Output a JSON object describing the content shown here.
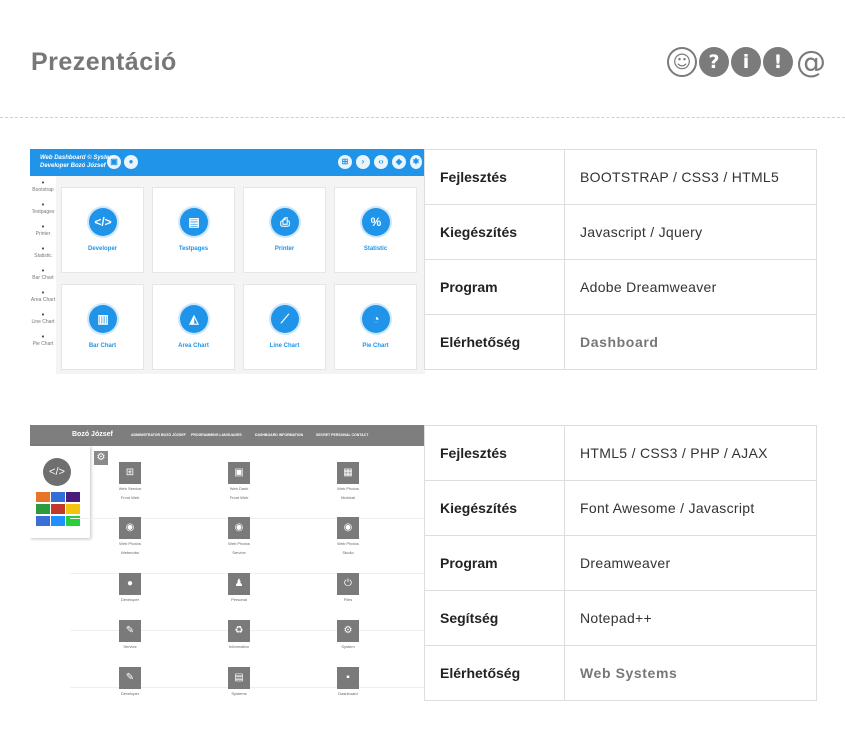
{
  "header": {
    "title": "Prezentáció",
    "icons": [
      {
        "name": "smile-icon",
        "glyph": "☺"
      },
      {
        "name": "question-icon",
        "glyph": "?"
      },
      {
        "name": "info-icon",
        "glyph": "i"
      },
      {
        "name": "exclamation-icon",
        "glyph": "!"
      },
      {
        "name": "at-icon",
        "glyph": "@"
      }
    ]
  },
  "project1": {
    "screenshot": {
      "brand_line1": "Web Dashboard © System",
      "brand_line2": "Developer Bozó József",
      "sidebar": [
        "Bootstrap",
        "Testpages",
        "Printer",
        "Statistic",
        "Bar Chart",
        "Area Chart",
        "Line Chart",
        "Pie Chart"
      ],
      "tiles": [
        {
          "label": "Developer",
          "glyph": "</>"
        },
        {
          "label": "Testpages",
          "glyph": "▤"
        },
        {
          "label": "Printer",
          "glyph": "⎙"
        },
        {
          "label": "Statistic",
          "glyph": "%"
        },
        {
          "label": "Bar Chart",
          "glyph": "▥"
        },
        {
          "label": "Area Chart",
          "glyph": "◭"
        },
        {
          "label": "Line Chart",
          "glyph": "⟋"
        },
        {
          "label": "Pie Chart",
          "glyph": "◔"
        }
      ]
    },
    "rows": [
      {
        "key": "Fejlesztés",
        "value": "BOOTSTRAP / CSS3 / HTML5"
      },
      {
        "key": "Kiegészítés",
        "value": "Javascript / Jquery"
      },
      {
        "key": "Program",
        "value": "Adobe Dreamweaver"
      },
      {
        "key": "Elérhetőség",
        "value": "Dashboard"
      }
    ]
  },
  "project2": {
    "screenshot": {
      "brand": "Bozó József",
      "nav": [
        "ADMINISTRATOR BOZÓ JÓZSEF",
        "PROGRAMMING LANGUAGES",
        "DASHBOARD INFORMATION",
        "SECRET PERSONAL CONTACT"
      ],
      "swatches": [
        "#e8742a",
        "#2f6fd6",
        "#4b1d7a",
        "#2c9a3d",
        "#c0392b",
        "#f1c40f",
        "#3b6fd8",
        "#1e90ff",
        "#27d03a"
      ],
      "cells": [
        {
          "glyph": "⊞",
          "l1": "Web Service",
          "l2": "Front Web"
        },
        {
          "glyph": "▣",
          "l1": "Web Dash",
          "l2": "Front Web"
        },
        {
          "glyph": "▦",
          "l1": "Web Photos",
          "l2": "Mobizal"
        },
        {
          "glyph": "◉",
          "l1": "Web Photos",
          "l2": "Webmobs"
        },
        {
          "glyph": "◉",
          "l1": "Web Photos",
          "l2": "Service"
        },
        {
          "glyph": "◉",
          "l1": "Web Photos",
          "l2": "Studio"
        },
        {
          "glyph": "●",
          "l1": "Developer",
          "l2": ""
        },
        {
          "glyph": "♟",
          "l1": "Personal",
          "l2": ""
        },
        {
          "glyph": "⏻",
          "l1": "Files",
          "l2": ""
        },
        {
          "glyph": "✎",
          "l1": "Service",
          "l2": ""
        },
        {
          "glyph": "♻",
          "l1": "Information",
          "l2": ""
        },
        {
          "glyph": "⚙",
          "l1": "System",
          "l2": ""
        },
        {
          "glyph": "✎",
          "l1": "Developer",
          "l2": ""
        },
        {
          "glyph": "▤",
          "l1": "Systems",
          "l2": ""
        },
        {
          "glyph": "▪",
          "l1": "Dashboard",
          "l2": ""
        }
      ]
    },
    "rows": [
      {
        "key": "Fejlesztés",
        "value": "HTML5 / CSS3 / PHP / AJAX"
      },
      {
        "key": "Kiegészítés",
        "value": "Font Awesome / Javascript"
      },
      {
        "key": "Program",
        "value": "Dreamweaver"
      },
      {
        "key": "Segítség",
        "value": "Notepad++"
      },
      {
        "key": "Elérhetőség",
        "value": "Web Systems"
      }
    ]
  }
}
